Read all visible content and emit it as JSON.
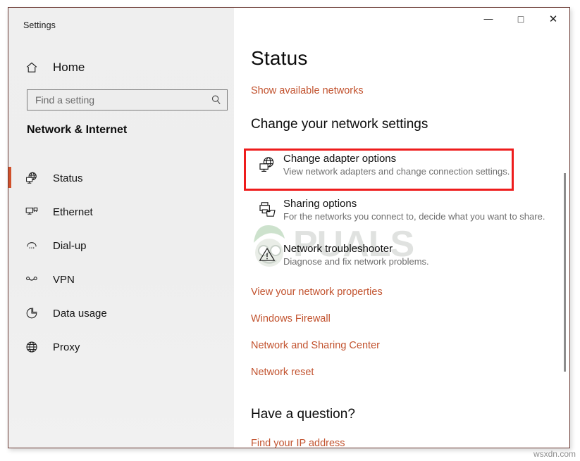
{
  "window": {
    "title": "Settings",
    "controls": {
      "minimize": "—",
      "maximize": "□",
      "close": "✕"
    }
  },
  "sidebar": {
    "home_label": "Home",
    "home_icon": "home-icon",
    "search": {
      "placeholder": "Find a setting",
      "value": "",
      "icon": "search-icon"
    },
    "category_title": "Network & Internet",
    "selected_index": 0,
    "accent_color": "#d0502a",
    "items": [
      {
        "label": "Status",
        "icon": "globe-monitor-icon",
        "selected": true
      },
      {
        "label": "Ethernet",
        "icon": "ethernet-icon",
        "selected": false
      },
      {
        "label": "Dial-up",
        "icon": "dialup-icon",
        "selected": false
      },
      {
        "label": "VPN",
        "icon": "vpn-key-icon",
        "selected": false
      },
      {
        "label": "Data usage",
        "icon": "pie-chart-icon",
        "selected": false
      },
      {
        "label": "Proxy",
        "icon": "globe-icon",
        "selected": false
      }
    ]
  },
  "main": {
    "page_title": "Status",
    "show_networks_link": "Show available networks",
    "section_heading": "Change your network settings",
    "link_color": "#c2532f",
    "settings_rows": [
      {
        "title": "Change adapter options",
        "description": "View network adapters and change connection settings.",
        "icon": "globe-monitor-icon",
        "highlighted": true
      },
      {
        "title": "Sharing options",
        "description": "For the networks you connect to, decide what you want to share.",
        "icon": "printer-share-icon",
        "highlighted": false
      },
      {
        "title": "Network troubleshooter",
        "description": "Diagnose and fix network problems.",
        "icon": "warning-triangle-icon",
        "highlighted": false
      }
    ],
    "links": [
      "View your network properties",
      "Windows Firewall",
      "Network and Sharing Center",
      "Network reset"
    ],
    "question_heading": "Have a question?",
    "find_ip_link": "Find your IP address",
    "highlight_color": "#ee1c1c"
  },
  "watermarks": {
    "brand": "PUALS",
    "site": "wsxdn.com"
  }
}
